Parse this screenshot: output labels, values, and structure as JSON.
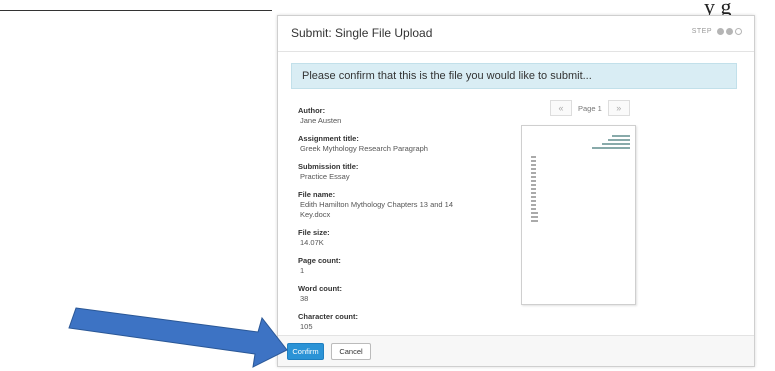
{
  "page": {
    "corner_text": "y g"
  },
  "dialog": {
    "title": "Submit: Single File Upload",
    "step_label": "STEP",
    "banner": "Please confirm that this is the file you would like to submit...",
    "fields": [
      {
        "label": "Author:",
        "value": "Jane Austen"
      },
      {
        "label": "Assignment title:",
        "value": "Greek Mythology Research Paragraph"
      },
      {
        "label": "Submission title:",
        "value": "Practice Essay"
      },
      {
        "label": "File name:",
        "value": "Edith Hamilton Mythology Chapters 13 and 14 Key.docx"
      },
      {
        "label": "File size:",
        "value": "14.07K"
      },
      {
        "label": "Page count:",
        "value": "1"
      },
      {
        "label": "Word count:",
        "value": "38"
      },
      {
        "label": "Character count:",
        "value": "105"
      }
    ],
    "pager": {
      "prev": "«",
      "label": "Page 1",
      "next": "»"
    },
    "buttons": {
      "confirm": "Confirm",
      "cancel": "Cancel"
    }
  },
  "colors": {
    "primary_button": "#2b93d6",
    "banner_bg": "#d9edf4",
    "arrow_fill": "#3d73c4"
  }
}
